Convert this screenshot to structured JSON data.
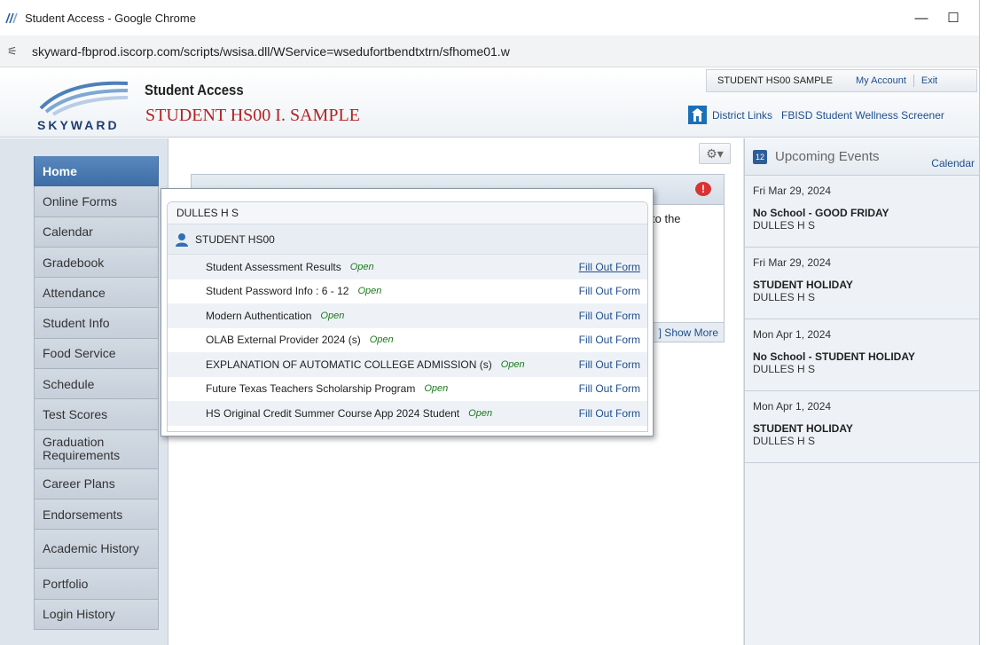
{
  "window": {
    "title": "Student Access - Google Chrome",
    "minimize": "—",
    "maximize": "☐"
  },
  "address": {
    "url": "skyward-fbprod.iscorp.com/scripts/wsisa.dll/WService=wsedufortbendtxtrn/sfhome01.w"
  },
  "header": {
    "brand": "SKYWARD",
    "app_name": "Student Access",
    "student_name": "STUDENT HS00 I. SAMPLE",
    "user": "STUDENT HS00 SAMPLE",
    "my_account": "My Account",
    "exit": "Exit",
    "district_links": "District Links",
    "wellness": "FBISD Student Wellness Screener"
  },
  "sidebar": {
    "items": [
      {
        "label": "Home"
      },
      {
        "label": "Online Forms"
      },
      {
        "label": "Calendar"
      },
      {
        "label": "Gradebook"
      },
      {
        "label": "Attendance"
      },
      {
        "label": "Student Info"
      },
      {
        "label": "Food Service"
      },
      {
        "label": "Schedule"
      },
      {
        "label": "Test Scores"
      },
      {
        "label": "Graduation Requirements"
      },
      {
        "label": "Career Plans"
      },
      {
        "label": "Endorsements"
      },
      {
        "label": "Academic History"
      },
      {
        "label": "Portfolio"
      },
      {
        "label": "Login History"
      }
    ]
  },
  "main": {
    "gear_icon": "⚙▾",
    "alert_bubble": "!",
    "to_the": "to the",
    "show_more": "] Show More"
  },
  "popup": {
    "school": "DULLES H S",
    "student": "STUDENT HS00",
    "forms": [
      {
        "name": "Student Assessment Results",
        "status": "Open",
        "action": "Fill Out Form"
      },
      {
        "name": "Student Password Info : 6 - 12",
        "status": "Open",
        "action": "Fill Out Form"
      },
      {
        "name": "Modern Authentication",
        "status": "Open",
        "action": "Fill Out Form"
      },
      {
        "name": "OLAB External Provider 2024 (s)",
        "status": "Open",
        "action": "Fill Out Form"
      },
      {
        "name": "EXPLANATION OF AUTOMATIC COLLEGE ADMISSION (s)",
        "status": "Open",
        "action": "Fill Out Form"
      },
      {
        "name": "Future Texas Teachers Scholarship Program",
        "status": "Open",
        "action": "Fill Out Form"
      },
      {
        "name": "HS Original Credit Summer Course App 2024 Student",
        "status": "Open",
        "action": "Fill Out Form"
      }
    ]
  },
  "events": {
    "title": "Upcoming Events",
    "calendar_link": "Calendar",
    "items": [
      {
        "date": "Fri Mar 29, 2024",
        "title": "No School - GOOD FRIDAY",
        "location": "DULLES H S"
      },
      {
        "date": "Fri Mar 29, 2024",
        "title": "STUDENT HOLIDAY",
        "location": "DULLES H S"
      },
      {
        "date": "Mon Apr 1, 2024",
        "title": "No School - STUDENT HOLIDAY",
        "location": "DULLES H S"
      },
      {
        "date": "Mon Apr 1, 2024",
        "title": "STUDENT HOLIDAY",
        "location": "DULLES H S"
      }
    ]
  }
}
